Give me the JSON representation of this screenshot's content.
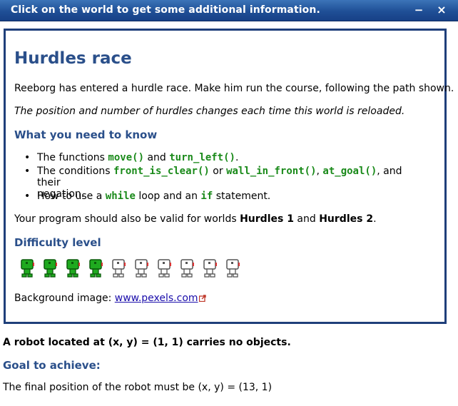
{
  "titlebar": {
    "title": "Click on the world to get some additional information.",
    "minimize_glyph": "−",
    "close_glyph": "×"
  },
  "panel": {
    "heading": "Hurdles race",
    "intro": "Reeborg has entered a hurdle race. Make him run the course, following the path shown.",
    "note": "The position and number of hurdles changes each time this world is reloaded.",
    "need_heading": "What you need to know",
    "bullets": {
      "b1": {
        "t1": "The functions ",
        "c1": "move()",
        "t2": " and ",
        "c2": "turn_left()",
        "t3": "."
      },
      "b2": {
        "t1": "The conditions ",
        "c1": "front_is_clear()",
        "t2": " or ",
        "c2": "wall_in_front()",
        "t3": ", ",
        "c3": "at_goal()",
        "t4": ", and their",
        "t5": "negation."
      },
      "b3": {
        "t1": "How to use a ",
        "c1": "while",
        "t2": " loop and an ",
        "c2": "if",
        "t3": " statement."
      }
    },
    "valid": {
      "t1": "Your program should also be valid for worlds ",
      "b1": "Hurdles 1",
      "t2": " and ",
      "b2": "Hurdles 2",
      "t3": "."
    },
    "difficulty_heading": "Difficulty level",
    "difficulty": {
      "level": 4,
      "max": 10
    },
    "background": {
      "label": "Background image: ",
      "link": "www.pexels.com",
      "link_icon": "external-link-icon"
    }
  },
  "robot_info": "A robot located at (x, y) = (1, 1) carries no objects.",
  "goal_heading": "Goal to achieve:",
  "goal_text": "The final position of the robot must be (x, y) = (13, 1)",
  "colors": {
    "title_bg": "#1f4f96",
    "heading": "#2a4f8a",
    "code": "#1a8a1a",
    "border": "#1f3f7a"
  }
}
